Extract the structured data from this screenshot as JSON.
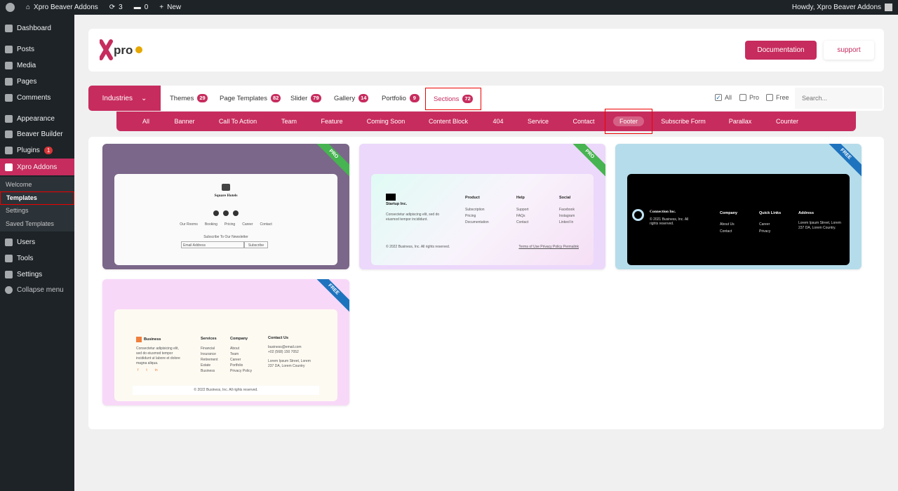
{
  "adminbar": {
    "site": "Xpro Beaver Addons",
    "updates": "3",
    "comments": "0",
    "new": "New",
    "howdy": "Howdy, Xpro Beaver Addons"
  },
  "sidebar": {
    "items": [
      {
        "label": "Dashboard"
      },
      {
        "label": "Posts"
      },
      {
        "label": "Media"
      },
      {
        "label": "Pages"
      },
      {
        "label": "Comments"
      },
      {
        "label": "Appearance"
      },
      {
        "label": "Beaver Builder"
      },
      {
        "label": "Plugins",
        "badge": "1"
      },
      {
        "label": "Xpro Addons"
      },
      {
        "label": "Users"
      },
      {
        "label": "Tools"
      },
      {
        "label": "Settings"
      },
      {
        "label": "Collapse menu"
      }
    ],
    "submenu": [
      {
        "label": "Welcome"
      },
      {
        "label": "Templates"
      },
      {
        "label": "Settings"
      },
      {
        "label": "Saved Templates"
      }
    ]
  },
  "header": {
    "logo": "Xpro Beaver Addons",
    "documentation": "Documentation",
    "support": "support"
  },
  "tabs": {
    "industries": "Industries",
    "items": [
      {
        "label": "Themes",
        "count": "29"
      },
      {
        "label": "Page Templates",
        "count": "82"
      },
      {
        "label": "Slider",
        "count": "79"
      },
      {
        "label": "Gallery",
        "count": "14"
      },
      {
        "label": "Portfolio",
        "count": "9"
      },
      {
        "label": "Sections",
        "count": "72"
      }
    ],
    "filters": {
      "all": "All",
      "pro": "Pro",
      "free": "Free"
    },
    "search_placeholder": "Search..."
  },
  "categories": [
    "All",
    "Banner",
    "Call To Action",
    "Team",
    "Feature",
    "Coming Soon",
    "Content Block",
    "404",
    "Service",
    "Contact",
    "Footer",
    "Subscribe Form",
    "Parallax",
    "Counter"
  ],
  "cards": [
    {
      "badge": "PRO",
      "title": "Square Hotels",
      "links": [
        "Our Rooms",
        "Booking",
        "Pricing",
        "Career",
        "Contact"
      ],
      "newsletter": "Subscribe To Our Newsletter",
      "email": "Email Address",
      "button": "Subscribe"
    },
    {
      "badge": "PRO",
      "title": "Startup Inc.",
      "desc": "Consectetur adipiscing elit, sed do eiusmod tempor incididunt.",
      "cols": [
        {
          "h": "Product",
          "l": [
            "Subscription",
            "Pricing",
            "Documentation"
          ]
        },
        {
          "h": "Help",
          "l": [
            "Support",
            "FAQs",
            "Contact"
          ]
        },
        {
          "h": "Social",
          "l": [
            "Facebook",
            "Instagram",
            "Linked In"
          ]
        }
      ],
      "copy": "© 2022 Business, Inc. All rights reserved.",
      "legal": "Terms of Use  Privacy Policy  Permalink"
    },
    {
      "badge": "FREE",
      "title": "Connection Inc.",
      "desc": "© 2021 Business, Inc. All rights reserved.",
      "cols": [
        {
          "h": "Company",
          "l": [
            "About Us",
            "Contact"
          ]
        },
        {
          "h": "Quick Links",
          "l": [
            "Career",
            "Privacy"
          ]
        },
        {
          "h": "Address",
          "l": [
            "Lorem Ipsum Street, Lorem 237 DA, Lorem Country."
          ]
        }
      ]
    },
    {
      "badge": "FREE",
      "title": "Business",
      "desc": "Consectetur adipisicing elit, sed do eiusmod tempor incididunt ut labore et dolore magna aliqua.",
      "cols": [
        {
          "h": "Services",
          "l": [
            "Financial",
            "Insurance",
            "Retirement",
            "Estate",
            "Business"
          ]
        },
        {
          "h": "Company",
          "l": [
            "About",
            "Team",
            "Career",
            "Portfolio",
            "Privacy Policy"
          ]
        },
        {
          "h": "Contact Us",
          "l": [
            "business@email.com",
            "+02 (568) 150 7052",
            "Lorem Ipsum Street, Lorem 237 DA, Lorem Country"
          ]
        }
      ],
      "copy": "© 2022 Business, Inc. All rights reserved."
    }
  ],
  "colors": {
    "accent": "#c72c5e",
    "pro": "#46b450",
    "free": "#1e73be"
  }
}
